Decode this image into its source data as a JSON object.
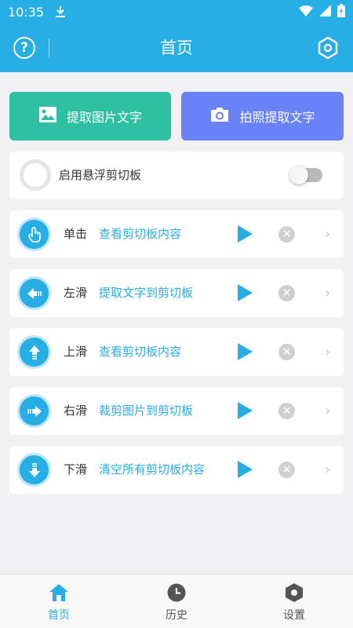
{
  "status_bar": {
    "time": "10:35"
  },
  "header": {
    "title": "首页",
    "help_glyph": "?"
  },
  "actions": {
    "extract_image_text": "提取图片文字",
    "photo_extract_text": "拍照提取文字"
  },
  "floating": {
    "label": "启用悬浮剪切板",
    "enabled": false
  },
  "gestures": [
    {
      "name": "单击",
      "action": "查看剪切板内容",
      "icon": "tap-icon"
    },
    {
      "name": "左滑",
      "action": "提取文字到剪切板",
      "icon": "arrow-left-icon"
    },
    {
      "name": "上滑",
      "action": "查看剪切板内容",
      "icon": "arrow-up-icon"
    },
    {
      "name": "右滑",
      "action": "裁剪图片到剪切板",
      "icon": "arrow-right-icon"
    },
    {
      "name": "下滑",
      "action": "清空所有剪切板内容",
      "icon": "arrow-down-icon"
    }
  ],
  "gesture_glyphs": {
    "remove": "×",
    "chevron": "›"
  },
  "tabs": [
    {
      "label": "首页",
      "icon": "home-icon",
      "active": true
    },
    {
      "label": "历史",
      "icon": "clock-icon",
      "active": false
    },
    {
      "label": "设置",
      "icon": "settings-icon",
      "active": false
    }
  ],
  "colors": {
    "primary": "#27aee4",
    "green_button": "#2ec0a0",
    "blue_button": "#6a82f7",
    "background": "#f1f1f3"
  }
}
